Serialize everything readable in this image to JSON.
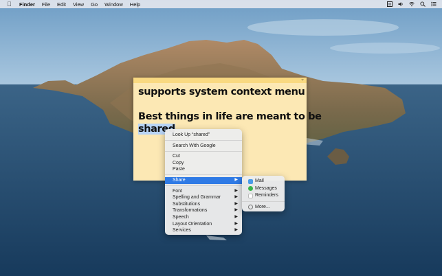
{
  "menubar": {
    "app_name": "Finder",
    "items": [
      "File",
      "Edit",
      "View",
      "Go",
      "Window",
      "Help"
    ]
  },
  "note": {
    "lines": [
      "supports system context menu",
      "",
      "Best things in life are meant to be"
    ],
    "selected_word": "shared",
    "color": "#fce8b4"
  },
  "context_menu": {
    "look_up": "Look Up “shared”",
    "search_google": "Search With Google",
    "cut": "Cut",
    "copy": "Copy",
    "paste": "Paste",
    "share": "Share",
    "font": "Font",
    "spelling": "Spelling and Grammar",
    "substitutions": "Substitutions",
    "transformations": "Transformations",
    "speech": "Speech",
    "layout_orientation": "Layout Orientation",
    "services": "Services",
    "submenu_arrow": "▶"
  },
  "share_submenu": {
    "mail": "Mail",
    "messages": "Messages",
    "reminders": "Reminders",
    "more": "More..."
  }
}
